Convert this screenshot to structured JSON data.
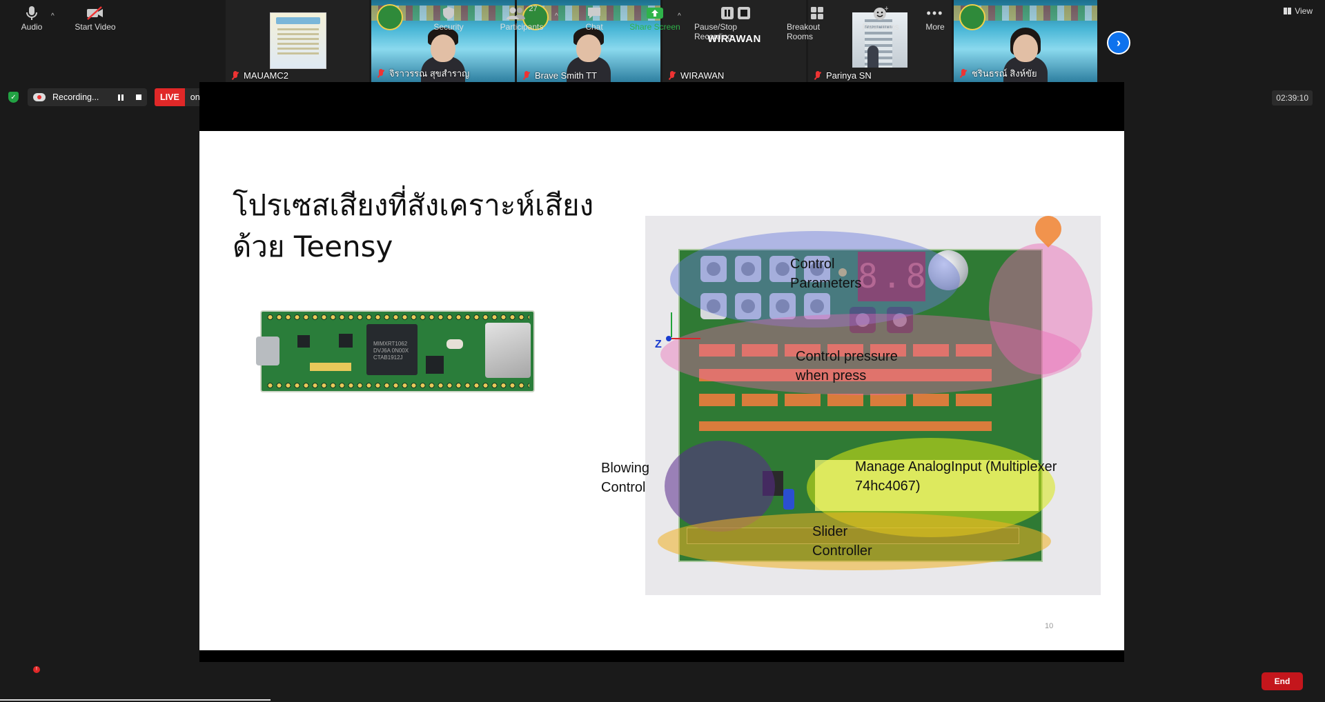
{
  "participants": [
    {
      "name": "MAUAMC2",
      "muted": true,
      "video": "poster"
    },
    {
      "name": "จิราวรรณ สุขสำราญ",
      "muted": true,
      "video": "camera"
    },
    {
      "name": "Brave Smith TT",
      "muted": true,
      "video": "camera",
      "active": true
    },
    {
      "name": "WIRAWAN",
      "muted": true,
      "video": "off",
      "big_name": "WIRAWAN"
    },
    {
      "name": "Parinya SN",
      "muted": true,
      "video": "photo"
    },
    {
      "name": "ชรินธรณ์ สิงห์ขัย",
      "muted": true,
      "video": "camera"
    }
  ],
  "view_label": "View",
  "recording": {
    "status": "Recording..."
  },
  "live": {
    "tag": "LIVE",
    "platform": "on Facebook"
  },
  "timer": "02:39:10",
  "slide": {
    "title_line1": "โปรเซสเสียงที่สังเคราะห์เสียง",
    "title_line2": "ด้วย Teensy",
    "page_number": "10",
    "chip_text": "MIMXRT1062 DVJ6A 0N00X CTAB1912J",
    "seven_segment": "8.8.",
    "axis_label": "Z",
    "annotations": {
      "control_parameters": [
        "Control",
        "Parameters"
      ],
      "control_pressure": [
        "Control pressure",
        "when press"
      ],
      "blowing_control": [
        "Blowing",
        "Control"
      ],
      "manage_analog": [
        "Manage AnalogInput (Multiplexer",
        "74hc4067)"
      ],
      "slider_controller": [
        "Slider",
        "Controller"
      ]
    }
  },
  "toolbar": {
    "audio": "Audio",
    "audio_badge": "!",
    "start_video": "Start Video",
    "security": "Security",
    "participants": "Participants",
    "participants_count": "27",
    "chat": "Chat",
    "share_screen": "Share Screen",
    "pause_stop_recording": "Pause/Stop Recording",
    "breakout_rooms": "Breakout Rooms",
    "reactions": "Reactions",
    "more": "More",
    "end": "End"
  },
  "colors": {
    "accent_blue": "#0e72ed",
    "live_red": "#e02828",
    "share_green": "#2fb34a",
    "end_red": "#c4161c"
  }
}
